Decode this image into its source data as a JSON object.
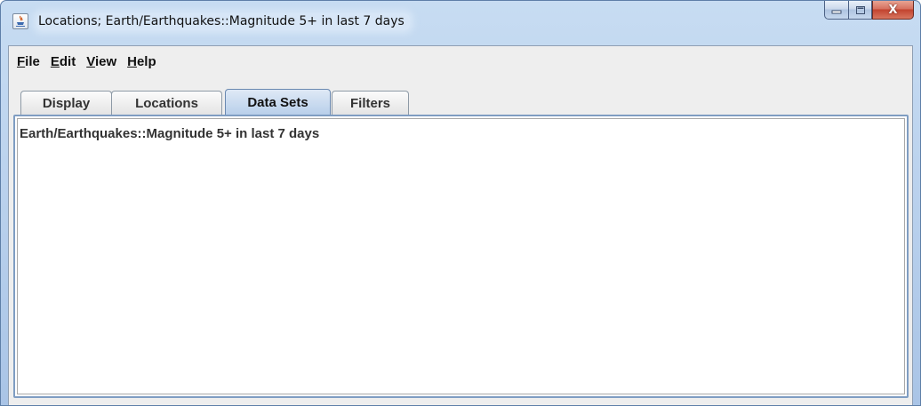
{
  "window": {
    "title": "Locations; Earth/Earthquakes::Magnitude 5+ in last 7 days",
    "icon": "java-icon",
    "caption_buttons": {
      "minimize_icon": "minimize-icon",
      "maximize_icon": "maximize-icon",
      "close_glyph": "X"
    }
  },
  "menubar": {
    "items": [
      {
        "label": "File",
        "mnemonic": "F",
        "rest": "ile"
      },
      {
        "label": "Edit",
        "mnemonic": "E",
        "rest": "dit"
      },
      {
        "label": "View",
        "mnemonic": "V",
        "rest": "iew"
      },
      {
        "label": "Help",
        "mnemonic": "H",
        "rest": "elp"
      }
    ]
  },
  "tabs": [
    {
      "label": "Display",
      "selected": false
    },
    {
      "label": "Locations",
      "selected": false
    },
    {
      "label": "Data Sets",
      "selected": true
    },
    {
      "label": "Filters",
      "selected": false
    }
  ],
  "content": {
    "datasets": [
      "Earth/Earthquakes::Magnitude 5+ in last 7 days"
    ]
  },
  "colors": {
    "title_bar": "#bcd3ee",
    "selected_tab": "#b8cfea",
    "close_button": "#c2432f",
    "panel_border": "#7f9dc2"
  }
}
